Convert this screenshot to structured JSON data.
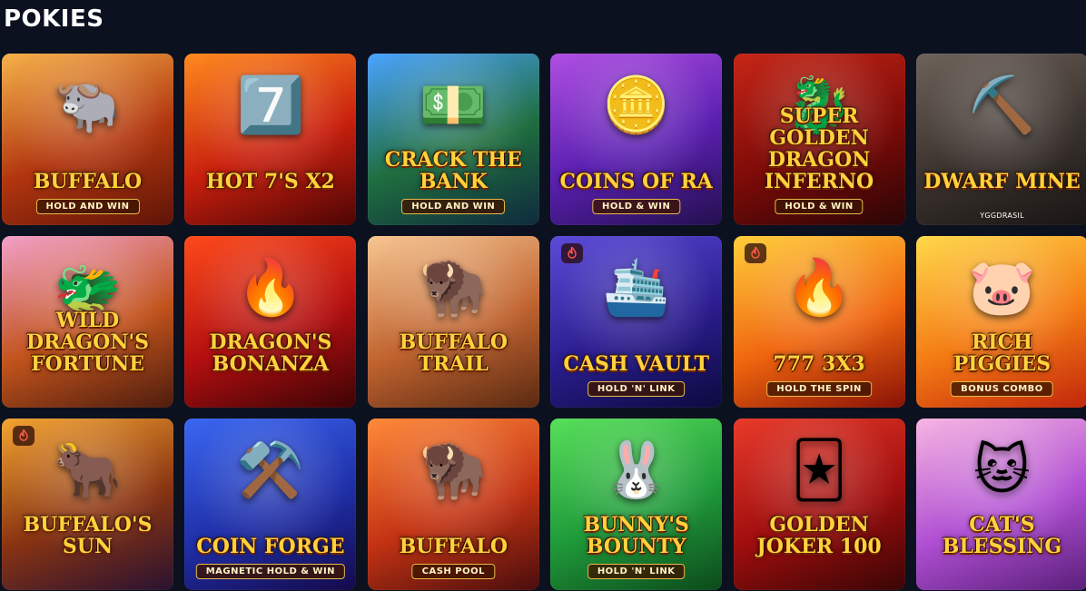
{
  "section": {
    "title": "POKIES"
  },
  "games": [
    {
      "name": "BUFFALO",
      "tag": "HOLD AND WIN",
      "hot": false,
      "art": "🐃",
      "provider": "",
      "bg": [
        "#f6b24a",
        "#b2360f",
        "#5e1407"
      ]
    },
    {
      "name": "HOT 7's x2",
      "tag": "",
      "hot": false,
      "art": "7️⃣",
      "provider": "",
      "bg": [
        "#ff8a1f",
        "#c81f0d",
        "#4d0505"
      ]
    },
    {
      "name": "CRACK THE BANK",
      "tag": "HOLD AND WIN",
      "hot": false,
      "art": "💵",
      "provider": "",
      "bg": [
        "#4aa3ff",
        "#1f6e3f",
        "#0f2a3e"
      ]
    },
    {
      "name": "COINS OF RA",
      "tag": "HOLD & WIN",
      "hot": false,
      "art": "🪙",
      "provider": "",
      "bg": [
        "#b04fe3",
        "#5a1fb0",
        "#24104f"
      ]
    },
    {
      "name": "Super GOLDEN DRAGON INFERNO",
      "tag": "HOLD & WIN",
      "hot": false,
      "art": "🐉",
      "provider": "",
      "bg": [
        "#c62616",
        "#7d0b08",
        "#2a0505"
      ]
    },
    {
      "name": "DWARF MINE",
      "tag": "",
      "hot": false,
      "art": "⛏️",
      "provider": "YGGDRASIL",
      "bg": [
        "#6e625a",
        "#3a322d",
        "#1a1614"
      ]
    },
    {
      "name": "WILD DRAGON'S FORTUNE",
      "tag": "",
      "hot": false,
      "art": "🐲",
      "provider": "",
      "bg": [
        "#f2a0c9",
        "#c2531c",
        "#4e1d0e"
      ]
    },
    {
      "name": "DRAGON'S BONANZA",
      "tag": "",
      "hot": false,
      "art": "🔥",
      "provider": "",
      "bg": [
        "#ff4a1a",
        "#b30f10",
        "#3d0305"
      ]
    },
    {
      "name": "BUFFALO TRAIL",
      "tag": "",
      "hot": false,
      "art": "🦬",
      "provider": "",
      "bg": [
        "#f6c692",
        "#c0632f",
        "#5a2a12"
      ]
    },
    {
      "name": "CASH VAULT",
      "tag": "HOLD 'N' LINK",
      "hot": true,
      "art": "🛳️",
      "provider": "",
      "bg": [
        "#5b4bd9",
        "#2b1d8f",
        "#0c0a3e"
      ]
    },
    {
      "name": "777 3x3",
      "tag": "HOLD THE SPIN",
      "hot": true,
      "art": "🔥",
      "provider": "",
      "bg": [
        "#ffce3a",
        "#f0660f",
        "#8a1206"
      ]
    },
    {
      "name": "RICH PIGGIES",
      "tag": "BONUS COMBO",
      "hot": false,
      "art": "🐷",
      "provider": "",
      "bg": [
        "#ffd84a",
        "#f47b14",
        "#c2260c"
      ]
    },
    {
      "name": "BUFFALO'S SUN",
      "tag": "",
      "hot": true,
      "art": "🐂",
      "provider": "",
      "bg": [
        "#f4a430",
        "#8a3412",
        "#2a1230"
      ]
    },
    {
      "name": "COIN FORGE",
      "tag": "MAGNETIC HOLD & WIN",
      "hot": false,
      "art": "⚒️",
      "provider": "",
      "bg": [
        "#3a67f2",
        "#1f2fa8",
        "#140a4a"
      ]
    },
    {
      "name": "BUFFALO",
      "tag": "CASH POOL",
      "hot": false,
      "art": "🦬",
      "provider": "",
      "bg": [
        "#ff8a3a",
        "#c33313",
        "#4a0d0d"
      ]
    },
    {
      "name": "BUNNY'S BOUNTY",
      "tag": "HOLD 'N' LINK",
      "hot": false,
      "art": "🐰",
      "provider": "",
      "bg": [
        "#58e05a",
        "#1f9a3a",
        "#0c4a1c"
      ]
    },
    {
      "name": "GOLDEN JOKER 100",
      "tag": "",
      "hot": false,
      "art": "🃏",
      "provider": "",
      "bg": [
        "#e83a2a",
        "#a00e0e",
        "#3a0505"
      ]
    },
    {
      "name": "CAT'S BLESSING",
      "tag": "",
      "hot": false,
      "art": "🐱",
      "provider": "",
      "bg": [
        "#f7b6e2",
        "#b04fd3",
        "#5a1f7a"
      ]
    }
  ]
}
